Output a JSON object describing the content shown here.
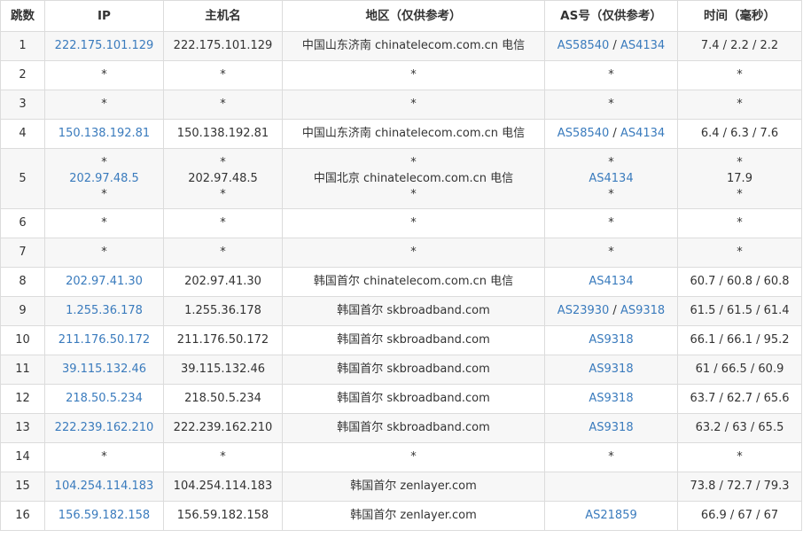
{
  "table": {
    "headers": [
      "跳数",
      "IP",
      "主机名",
      "地区（仅供参考）",
      "AS号（仅供参考）",
      "时间（毫秒）"
    ],
    "rows": [
      {
        "hop": "1",
        "ip": [
          "222.175.101.129"
        ],
        "host": [
          "222.175.101.129"
        ],
        "region": [
          "中国山东济南 chinatelecom.com.cn 电信"
        ],
        "as": [
          [
            "AS58540",
            "AS4134"
          ]
        ],
        "time": [
          "7.4 / 2.2 / 2.2"
        ]
      },
      {
        "hop": "2",
        "ip": [
          "*"
        ],
        "host": [
          "*"
        ],
        "region": [
          "*"
        ],
        "as": [
          [
            "*"
          ]
        ],
        "time": [
          "*"
        ]
      },
      {
        "hop": "3",
        "ip": [
          "*"
        ],
        "host": [
          "*"
        ],
        "region": [
          "*"
        ],
        "as": [
          [
            "*"
          ]
        ],
        "time": [
          "*"
        ]
      },
      {
        "hop": "4",
        "ip": [
          "150.138.192.81"
        ],
        "host": [
          "150.138.192.81"
        ],
        "region": [
          "中国山东济南 chinatelecom.com.cn 电信"
        ],
        "as": [
          [
            "AS58540",
            "AS4134"
          ]
        ],
        "time": [
          "6.4 / 6.3 / 7.6"
        ]
      },
      {
        "hop": "5",
        "ip": [
          "*",
          "202.97.48.5",
          "*"
        ],
        "host": [
          "*",
          "202.97.48.5",
          "*"
        ],
        "region": [
          "*",
          "中国北京 chinatelecom.com.cn 电信",
          "*"
        ],
        "as": [
          [
            "*"
          ],
          [
            "AS4134"
          ],
          [
            "*"
          ]
        ],
        "time": [
          "*",
          "17.9",
          "*"
        ]
      },
      {
        "hop": "6",
        "ip": [
          "*"
        ],
        "host": [
          "*"
        ],
        "region": [
          "*"
        ],
        "as": [
          [
            "*"
          ]
        ],
        "time": [
          "*"
        ]
      },
      {
        "hop": "7",
        "ip": [
          "*"
        ],
        "host": [
          "*"
        ],
        "region": [
          "*"
        ],
        "as": [
          [
            "*"
          ]
        ],
        "time": [
          "*"
        ]
      },
      {
        "hop": "8",
        "ip": [
          "202.97.41.30"
        ],
        "host": [
          "202.97.41.30"
        ],
        "region": [
          "韩国首尔 chinatelecom.com.cn 电信"
        ],
        "as": [
          [
            "AS4134"
          ]
        ],
        "time": [
          "60.7 / 60.8 / 60.8"
        ]
      },
      {
        "hop": "9",
        "ip": [
          "1.255.36.178"
        ],
        "host": [
          "1.255.36.178"
        ],
        "region": [
          "韩国首尔 skbroadband.com"
        ],
        "as": [
          [
            "AS23930",
            "AS9318"
          ]
        ],
        "time": [
          "61.5 / 61.5 / 61.4"
        ]
      },
      {
        "hop": "10",
        "ip": [
          "211.176.50.172"
        ],
        "host": [
          "211.176.50.172"
        ],
        "region": [
          "韩国首尔 skbroadband.com"
        ],
        "as": [
          [
            "AS9318"
          ]
        ],
        "time": [
          "66.1 / 66.1 / 95.2"
        ]
      },
      {
        "hop": "11",
        "ip": [
          "39.115.132.46"
        ],
        "host": [
          "39.115.132.46"
        ],
        "region": [
          "韩国首尔 skbroadband.com"
        ],
        "as": [
          [
            "AS9318"
          ]
        ],
        "time": [
          "61 / 66.5 / 60.9"
        ]
      },
      {
        "hop": "12",
        "ip": [
          "218.50.5.234"
        ],
        "host": [
          "218.50.5.234"
        ],
        "region": [
          "韩国首尔 skbroadband.com"
        ],
        "as": [
          [
            "AS9318"
          ]
        ],
        "time": [
          "63.7 / 62.7 / 65.6"
        ]
      },
      {
        "hop": "13",
        "ip": [
          "222.239.162.210"
        ],
        "host": [
          "222.239.162.210"
        ],
        "region": [
          "韩国首尔 skbroadband.com"
        ],
        "as": [
          [
            "AS9318"
          ]
        ],
        "time": [
          "63.2 / 63 / 65.5"
        ]
      },
      {
        "hop": "14",
        "ip": [
          "*"
        ],
        "host": [
          "*"
        ],
        "region": [
          "*"
        ],
        "as": [
          [
            "*"
          ]
        ],
        "time": [
          "*"
        ]
      },
      {
        "hop": "15",
        "ip": [
          "104.254.114.183"
        ],
        "host": [
          "104.254.114.183"
        ],
        "region": [
          "韩国首尔 zenlayer.com"
        ],
        "as": [
          []
        ],
        "time": [
          "73.8 / 72.7 / 79.3"
        ]
      },
      {
        "hop": "16",
        "ip": [
          "156.59.182.158"
        ],
        "host": [
          "156.59.182.158"
        ],
        "region": [
          "韩国首尔 zenlayer.com"
        ],
        "as": [
          [
            "AS21859"
          ]
        ],
        "time": [
          "66.9 / 67 / 67"
        ]
      }
    ]
  },
  "colors": {
    "link": "#3a7bbd",
    "text": "#333333",
    "border": "#dcdcdc",
    "stripe": "#f7f7f7"
  }
}
